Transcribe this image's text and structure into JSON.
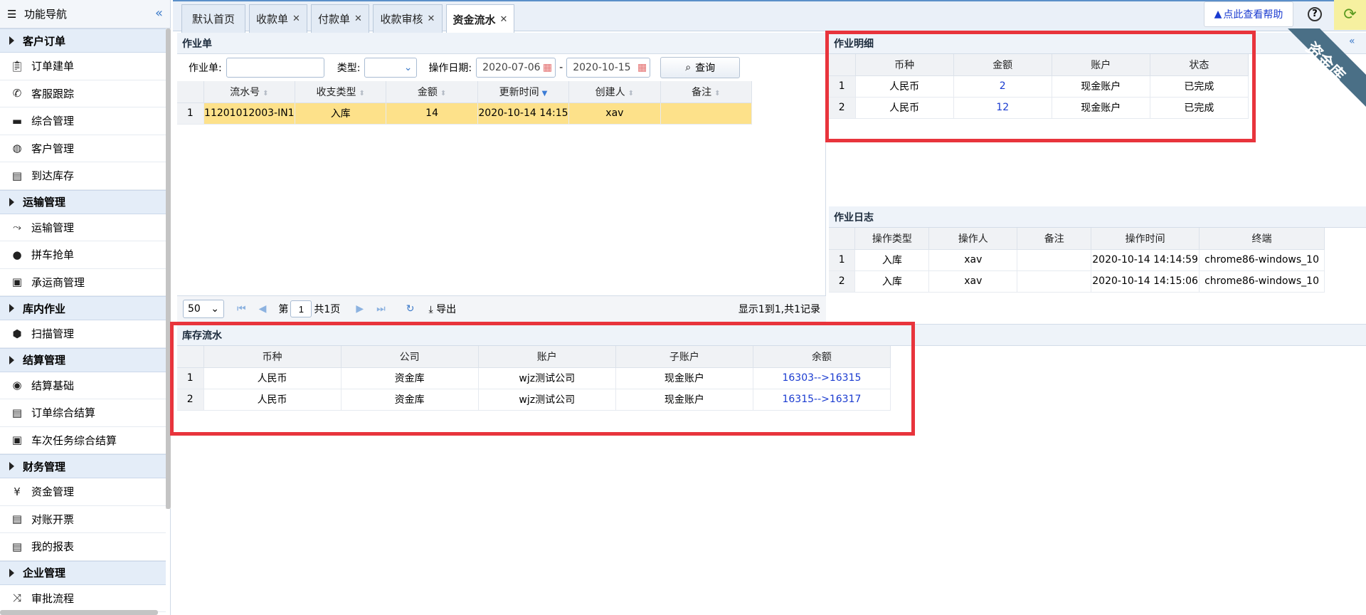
{
  "sidebar": {
    "title": "功能导航",
    "groups": [
      {
        "label": "客户订单",
        "items": [
          {
            "label": "订单建单",
            "icon": "clipboard-icon"
          },
          {
            "label": "客服跟踪",
            "icon": "phone-icon"
          },
          {
            "label": "综合管理",
            "icon": "monitor-icon"
          },
          {
            "label": "客户管理",
            "icon": "user-circle-icon"
          },
          {
            "label": "到达库存",
            "icon": "document-icon"
          }
        ]
      },
      {
        "label": "运输管理",
        "items": [
          {
            "label": "运输管理",
            "icon": "route-icon"
          },
          {
            "label": "拼车抢单",
            "icon": "map-pin-icon"
          },
          {
            "label": "承运商管理",
            "icon": "bus-icon"
          }
        ]
      },
      {
        "label": "库内作业",
        "items": [
          {
            "label": "扫描管理",
            "icon": "box-icon"
          }
        ]
      },
      {
        "label": "结算管理",
        "items": [
          {
            "label": "结算基础",
            "icon": "eye-icon"
          },
          {
            "label": "订单综合结算",
            "icon": "document-icon"
          },
          {
            "label": "车次任务综合结算",
            "icon": "bus-icon"
          }
        ]
      },
      {
        "label": "财务管理",
        "items": [
          {
            "label": "资金管理",
            "icon": "yen-icon"
          },
          {
            "label": "对账开票",
            "icon": "document-icon"
          },
          {
            "label": "我的报表",
            "icon": "document-icon"
          }
        ]
      },
      {
        "label": "企业管理",
        "items": [
          {
            "label": "审批流程",
            "icon": "shuffle-icon"
          }
        ]
      }
    ]
  },
  "tabs": [
    {
      "label": "默认首页",
      "closable": false
    },
    {
      "label": "收款单",
      "closable": true
    },
    {
      "label": "付款单",
      "closable": true
    },
    {
      "label": "收款审核",
      "closable": true
    },
    {
      "label": "资金流水",
      "closable": true,
      "active": true
    }
  ],
  "topbar": {
    "help_label": "点此查看帮助",
    "ribbon_label": "资金库"
  },
  "work_order": {
    "title": "作业单",
    "filters": {
      "order_label": "作业单:",
      "order_value": "",
      "type_label": "类型:",
      "type_value": "",
      "date_label": "操作日期:",
      "date_from": "2020-07-06",
      "date_sep": "-",
      "date_to": "2020-10-15",
      "search_label": "查询"
    },
    "columns": [
      "流水号",
      "收支类型",
      "金额",
      "更新时间",
      "创建人",
      "备注"
    ],
    "rows": [
      {
        "n": "1",
        "cells": [
          "11201012003-IN1",
          "入库",
          "14",
          "2020-10-14 14:15",
          "xav",
          ""
        ]
      }
    ],
    "pager": {
      "page_size": "50",
      "page_prefix": "第",
      "page_value": "1",
      "page_total": "共1页",
      "export_label": "导出",
      "summary": "显示1到1,共1记录"
    }
  },
  "detail": {
    "title": "作业明细",
    "columns": [
      "币种",
      "金额",
      "账户",
      "状态"
    ],
    "rows": [
      {
        "n": "1",
        "cells": [
          "人民币",
          "2",
          "现金账户",
          "已完成"
        ]
      },
      {
        "n": "2",
        "cells": [
          "人民币",
          "12",
          "现金账户",
          "已完成"
        ]
      }
    ]
  },
  "log": {
    "title": "作业日志",
    "columns": [
      "操作类型",
      "操作人",
      "备注",
      "操作时间",
      "终端"
    ],
    "rows": [
      {
        "n": "1",
        "cells": [
          "入库",
          "xav",
          "",
          "2020-10-14 14:14:59",
          "chrome86-windows_10"
        ]
      },
      {
        "n": "2",
        "cells": [
          "入库",
          "xav",
          "",
          "2020-10-14 14:15:06",
          "chrome86-windows_10"
        ]
      }
    ]
  },
  "stock": {
    "title": "库存流水",
    "columns": [
      "币种",
      "公司",
      "账户",
      "子账户",
      "余额"
    ],
    "rows": [
      {
        "n": "1",
        "cells": [
          "人民币",
          "资金库",
          "wjz测试公司",
          "现金账户",
          "16303-->16315"
        ]
      },
      {
        "n": "2",
        "cells": [
          "人民币",
          "资金库",
          "wjz测试公司",
          "现金账户",
          "16315-->16317"
        ]
      }
    ]
  },
  "colors": {
    "accent": "#3c7ac9",
    "highlight_row": "#fde18a",
    "annotation_box": "#e8343c",
    "link": "#1a3bd0",
    "ribbon": "#4a6f86"
  }
}
